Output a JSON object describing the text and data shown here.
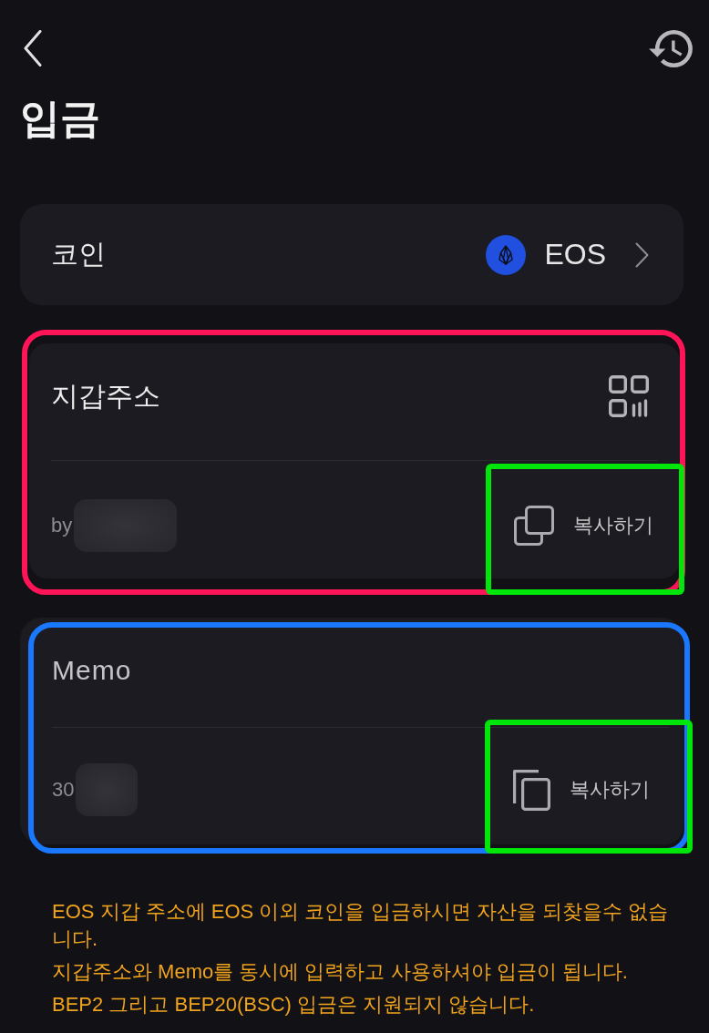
{
  "header": {
    "title": "입금"
  },
  "coin_selector": {
    "label": "코인",
    "value": "EOS"
  },
  "cards": [
    {
      "kind": "address",
      "title": "지갑주소",
      "value": "by",
      "copy_label": "복사하기",
      "annotation": {
        "color": "#ff1458"
      },
      "copy_annotation": {
        "color": "#00e60a"
      }
    },
    {
      "kind": "memo",
      "title": "Memo",
      "value": "30",
      "copy_label": "복사하기",
      "annotation": {
        "color": "#1a78ff"
      },
      "copy_annotation": {
        "color": "#00e60a"
      }
    }
  ],
  "notices": [
    "EOS 지갑 주소에 EOS 이외 코인을 입금하시면 자산을 되찾을수 없습니다.",
    "지갑주소와 Memo를 동시에 입력하고 사용하셔야 입금이 됩니다.",
    "BEP2 그리고 BEP20(BSC) 입금은 지원되지 않습니다."
  ]
}
